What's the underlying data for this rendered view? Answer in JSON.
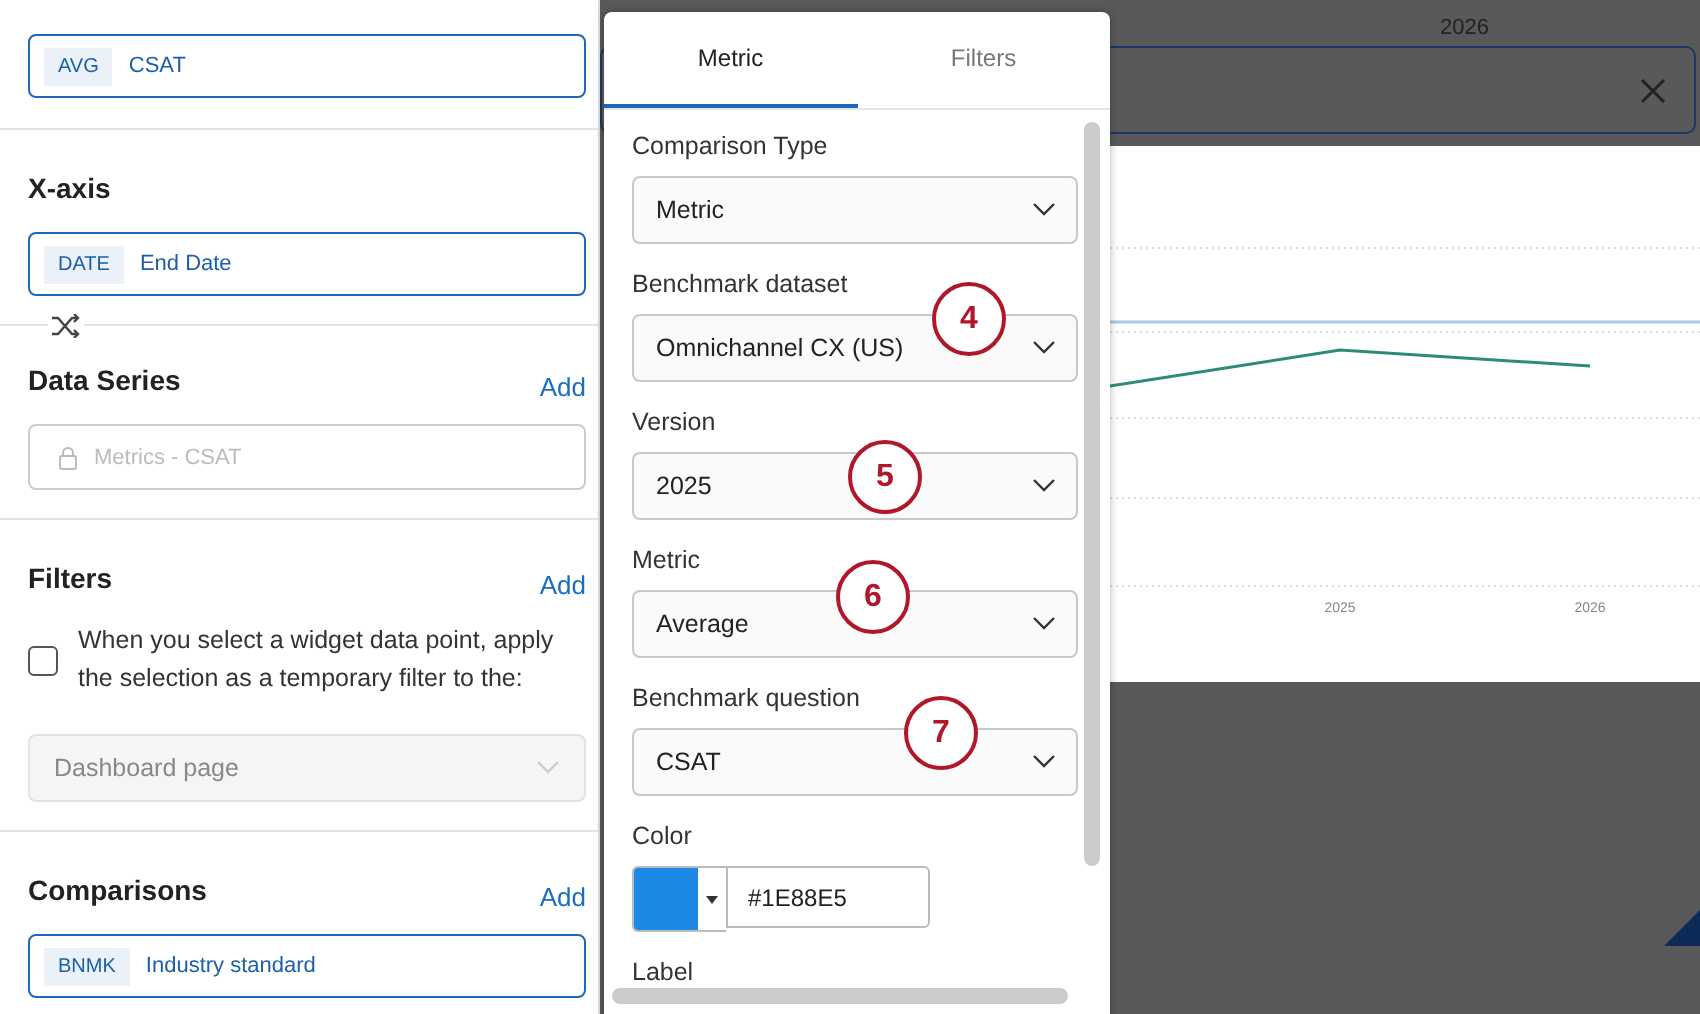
{
  "metric": {
    "tag": "AVG",
    "label": "CSAT"
  },
  "x_axis": {
    "title": "X-axis",
    "tag": "DATE",
    "label": "End Date"
  },
  "data_series": {
    "title": "Data Series",
    "action": "Add",
    "field": {
      "value": "Metrics - CSAT",
      "disabled": true
    }
  },
  "filters": {
    "title": "Filters",
    "action": "Add",
    "checkbox": {
      "label": "When you select a widget data point, apply the selection as a temporary filter to the:",
      "checked": false
    },
    "select": {
      "value": "Dashboard page",
      "disabled": true
    }
  },
  "comparisons": {
    "title": "Comparisons",
    "action": "Add",
    "items": [
      {
        "tag": "BNMK",
        "label": "Industry standard"
      }
    ]
  },
  "popover": {
    "tabs": [
      {
        "label": "Metric",
        "selected": true
      },
      {
        "label": "Filters",
        "selected": false
      }
    ],
    "fields": [
      {
        "kind": "select",
        "label": "Comparison Type",
        "value": "Metric"
      },
      {
        "kind": "select",
        "label": "Benchmark dataset",
        "value": "Omnichannel CX (US)"
      },
      {
        "kind": "select",
        "label": "Version",
        "value": "2025"
      },
      {
        "kind": "select",
        "label": "Metric",
        "value": "Average"
      },
      {
        "kind": "select",
        "label": "Benchmark question",
        "value": "CSAT"
      },
      {
        "kind": "color",
        "label": "Color",
        "value": "#1E88E5"
      },
      {
        "kind": "heading",
        "label": "Label"
      }
    ]
  },
  "annotations": [
    "4",
    "5",
    "6",
    "7"
  ],
  "background": {
    "top_label": "2026",
    "x_labels": [
      "2025",
      "2026"
    ]
  }
}
